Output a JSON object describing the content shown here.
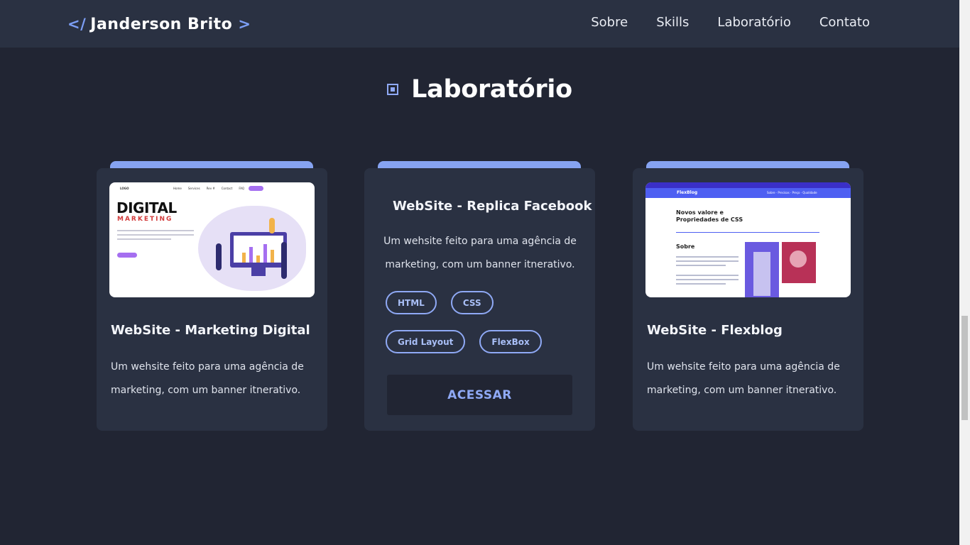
{
  "header": {
    "logo_code": "</",
    "logo_name": "Janderson Brito",
    "logo_chevron": ">",
    "nav": [
      "Sobre",
      "Skills",
      "Laboratório",
      "Contato"
    ]
  },
  "section": {
    "title": "Laboratório"
  },
  "cards": [
    {
      "title": "WebSite - Marketing Digital",
      "description": "Um wehsite feito para uma agência de marketing, com um banner itnerativo.",
      "thumbnail": {
        "logo": "LOGO",
        "links": [
          "Home",
          "Services",
          "Rev #",
          "Contact",
          "FAQ"
        ],
        "heading": "DIGITAL",
        "subheading": "MARKETING"
      }
    },
    {
      "title": "WebSite - Replica Facebook",
      "description": "Um wehsite feito para uma agência de marketing, com um banner itnerativo.",
      "tags": [
        "HTML",
        "CSS",
        "Grid Layout",
        "FlexBox"
      ],
      "button": "ACESSAR"
    },
    {
      "title": "WebSite - Flexblog",
      "description": "Um wehsite feito para uma agência de marketing, com um banner itnerativo.",
      "thumbnail": {
        "logo": "FlexBlog",
        "links": "Sobre · Precisas · Preço · Qualidade",
        "heading_line1": "Novos valore e",
        "heading_line2": "Propriedades de CSS",
        "section": "Sobre"
      }
    }
  ],
  "colors": {
    "background": "#212533",
    "header": "#2a3142",
    "card": "#2a3142",
    "accent": "#86a3f1"
  }
}
